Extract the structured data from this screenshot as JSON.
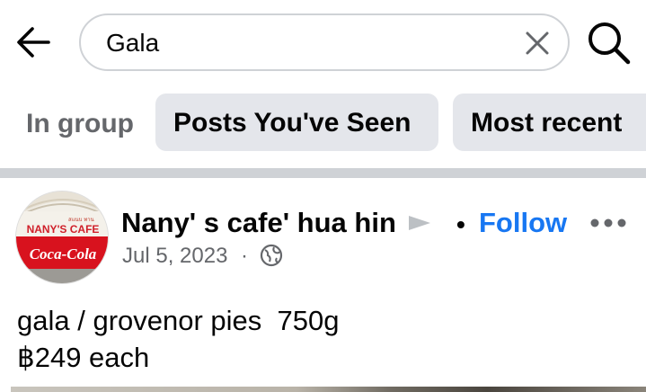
{
  "search": {
    "query": "Gala"
  },
  "filters": {
    "label": "In group",
    "chips": [
      "Posts You've Seen",
      "Most recent"
    ]
  },
  "post": {
    "avatar": {
      "sign_text": "NANY'S CAFE",
      "brand": "Coca-Cola",
      "small_text": "สแนบ ทาน"
    },
    "author": "Nany' s cafe' hua hin",
    "separator": "•",
    "follow_label": "Follow",
    "date": "Jul 5, 2023",
    "meta_sep": "·",
    "body_lines": [
      "gala / grovenor pies  750g",
      "฿249 each"
    ]
  },
  "colors": {
    "accent": "#1877f2",
    "chip_bg": "#e4e6eb",
    "secondary_text": "#65676b"
  },
  "icons": [
    "back-arrow-icon",
    "clear-icon",
    "search-icon",
    "share-arrow-icon",
    "more-icon",
    "globe-icon"
  ]
}
